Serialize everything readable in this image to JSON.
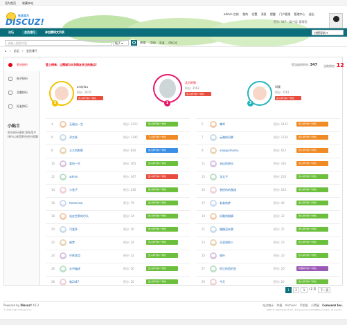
{
  "topbar": {
    "set_home": "设为首页",
    "bookmark": "收藏本站"
  },
  "logo": {
    "subtitle": "社区动力",
    "text": "DISCUZ!"
  },
  "userlinks": [
    "admin 在线",
    "我的",
    "设置",
    "消息",
    "提醒",
    "门户管理",
    "管理中心",
    "退出"
  ],
  "credits": "积分: 347 · 用户组: 管理员",
  "nav": {
    "items": [
      "论坛",
      "会员排行",
      "参加腾网文列表"
    ],
    "quicknav": "快捷导航"
  },
  "search": {
    "placeholder": "请输入搜索内容",
    "scope": "帖子",
    "hot_label": "热搜:",
    "hot": [
      "活动",
      "交友",
      "discuz"
    ]
  },
  "breadcrumb": [
    "论坛",
    "会员排行"
  ],
  "sidebar": {
    "items": [
      {
        "label": "积分排行",
        "icon": "heart-icon"
      },
      {
        "label": "帖子排行",
        "icon": "post-icon"
      },
      {
        "label": "主题排行",
        "icon": "topic-icon"
      },
      {
        "label": "好友排行",
        "icon": "friend-icon"
      }
    ],
    "tip_title": "小贴士",
    "tip_text": "积分排行规则:您所用户排行以来是那些进行换算"
  },
  "content": {
    "promo": "登上榜单，让围城为众多网友关注的焦点!",
    "my_credit_label": "您当前的积分:",
    "my_credit": "347",
    "my_rank_label": "当前排名:",
    "my_rank": "12"
  },
  "top3": [
    {
      "rank": "2",
      "name": "andylau",
      "score": "积分: 2876",
      "button": "送入排行前1个排位"
    },
    {
      "rank": "1",
      "name": "北方的狼",
      "score": "积分: 3562",
      "button": "送入排行前1个排位"
    },
    {
      "rank": "3",
      "name": "叫我",
      "score": "积分: 2561",
      "button": "送入排行前1个排位"
    }
  ],
  "ranking_left": [
    {
      "rank": "4",
      "name": "无敌出一生",
      "score": "积分: 2123",
      "button": "送入排行前1个排位"
    },
    {
      "rank": "6",
      "name": "邓文跃",
      "score": "积分: 1345",
      "button": "飞入排行前1个排位"
    },
    {
      "rank": "8",
      "name": "王大的那那",
      "score": "积分: 826",
      "button": "送入排行前1个排位"
    },
    {
      "rank": "10",
      "name": "爱的一生",
      "score": "积分: 565",
      "button": "送入排行前1个排位"
    },
    {
      "rank": "12",
      "name": "admin",
      "score": "积分: 347",
      "button": "送入排行前1个排位"
    },
    {
      "rank": "14",
      "name": "小兔子",
      "score": "积分: 216",
      "button": "送入排行前1个排位"
    },
    {
      "rank": "16",
      "name": "tomorrow",
      "score": "积分: 79",
      "button": "送入排行前1个排位"
    },
    {
      "rank": "18",
      "name": "站在世界的尽头",
      "score": "积分: 34",
      "button": "送入排行前1个排位"
    },
    {
      "rank": "20",
      "name": "可爱多",
      "score": "积分: 26",
      "button": "送入排行前1个排位"
    },
    {
      "rank": "22",
      "name": "倦梦",
      "score": "积分: 24",
      "button": "送入排行前1个排位"
    },
    {
      "rank": "24",
      "name": "兴晖家用",
      "score": "积分: 22",
      "button": "送入排行前1个排位"
    },
    {
      "rank": "26",
      "name": "水中幽迹",
      "score": "积分: 20",
      "button": "送入排行前1个排位"
    },
    {
      "rank": "28",
      "name": "和2447",
      "score": "积分: 20",
      "button": "送入排行前1个排位"
    }
  ],
  "ranking_right": [
    {
      "rank": "5",
      "name": "尊师",
      "score": "积分: 1432",
      "button": "送入排行前1个排位"
    },
    {
      "rank": "7",
      "name": "云端的风景",
      "score": "积分: 1234",
      "button": "送入排行前1个排位"
    },
    {
      "rank": "9",
      "name": "xiaoguimumu",
      "score": "积分: 612",
      "button": "送入排行前1个排位"
    },
    {
      "rank": "11",
      "name": "永远的快乐",
      "score": "积分: 432",
      "button": "送入排行前1个排位"
    },
    {
      "rank": "13",
      "name": "龙太子",
      "score": "积分: 233",
      "button": "送入排行前1个排位"
    },
    {
      "rank": "15",
      "name": "曾经的的我旅",
      "score": "积分: 122",
      "button": "送入排行前1个排位"
    },
    {
      "rank": "17",
      "name": "若若的梦",
      "score": "积分: 46",
      "button": "送入排行前1个排位"
    },
    {
      "rank": "19",
      "name": "好眼的眼睛",
      "score": "积分: 32",
      "button": "送入排行前1个排位"
    },
    {
      "rank": "21",
      "name": "慢慢没有我",
      "score": "积分: 25",
      "button": "送入排行前1个排位"
    },
    {
      "rank": "23",
      "name": "天涯和那人",
      "score": "积分: 23",
      "button": "送入排行前1个排位"
    },
    {
      "rank": "25",
      "name": "银叶",
      "score": "积分: 20",
      "button": "送入排行前1个排位"
    },
    {
      "rank": "27",
      "name": "阿正的西伯亚",
      "score": "积分: 20",
      "button": "管理排行前1个排位"
    },
    {
      "rank": "29",
      "name": "今天",
      "score": "积分: 20",
      "button": "送入排行前1个排位"
    }
  ],
  "pager": {
    "pages": [
      "1",
      "2"
    ],
    "jump": "1",
    "total": "/ 2 页",
    "next": "下一页"
  },
  "footer": {
    "powered": "Powered by",
    "brand": "Discuz!",
    "version": "X3.2",
    "copyright": "© 2001-2013 Comsenz Inc.",
    "links": [
      "站点统计",
      "举报",
      "Archiver",
      "手机版",
      "小黑屋",
      "Comsenz Inc."
    ],
    "stats": "GMT+8, 2016-8-16 15:18 , Processed in 0.079286 second(s), 12 queries ."
  },
  "colors": {
    "brand": "#0c6e7a",
    "accent": "#e60012",
    "link": "#1e6bb8"
  }
}
